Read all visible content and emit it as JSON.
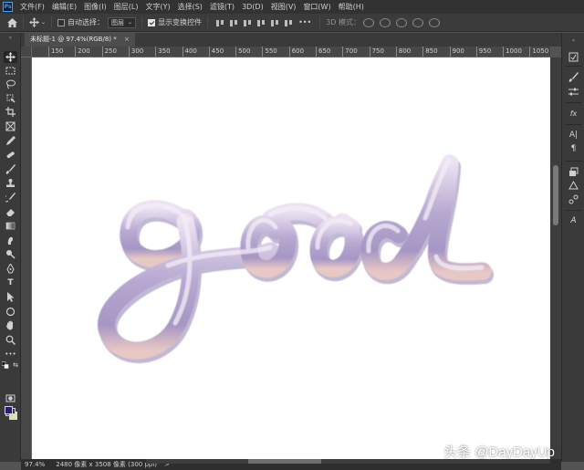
{
  "app": {
    "logo": "Ps",
    "menu": [
      "文件(F)",
      "编辑(E)",
      "图像(I)",
      "图层(L)",
      "文字(Y)",
      "选择(S)",
      "滤镜(T)",
      "3D(D)",
      "视图(V)",
      "窗口(W)",
      "帮助(H)"
    ]
  },
  "options": {
    "auto_select_label": "自动选择：",
    "auto_select_value": "图层",
    "show_transform_label": "显示变换控件",
    "mode_3d_label": "3D 模式："
  },
  "document": {
    "tab_title": "未标题-1 @ 97.4%(RGB/8) *",
    "artwork_text": "good"
  },
  "ruler": {
    "labels": [
      "150",
      "200",
      "250",
      "300",
      "350",
      "400",
      "450",
      "500",
      "550",
      "600",
      "650",
      "700",
      "750",
      "800",
      "850",
      "900",
      "950",
      "1000",
      "1050"
    ]
  },
  "status": {
    "zoom": "97.4%",
    "doc_size": "2480 像素 x 3508 像素 (300 ppi)",
    "arrow": ">"
  },
  "colors": {
    "foreground": "#2a1e6b",
    "background": "#dde4a9",
    "stroke_light": "#ece2f2",
    "stroke_mid": "#b8a9d1",
    "stroke_shadow": "#8f7fb0",
    "stroke_warm": "#e8c8c4"
  },
  "watermark": "头条 @DayDayUp"
}
